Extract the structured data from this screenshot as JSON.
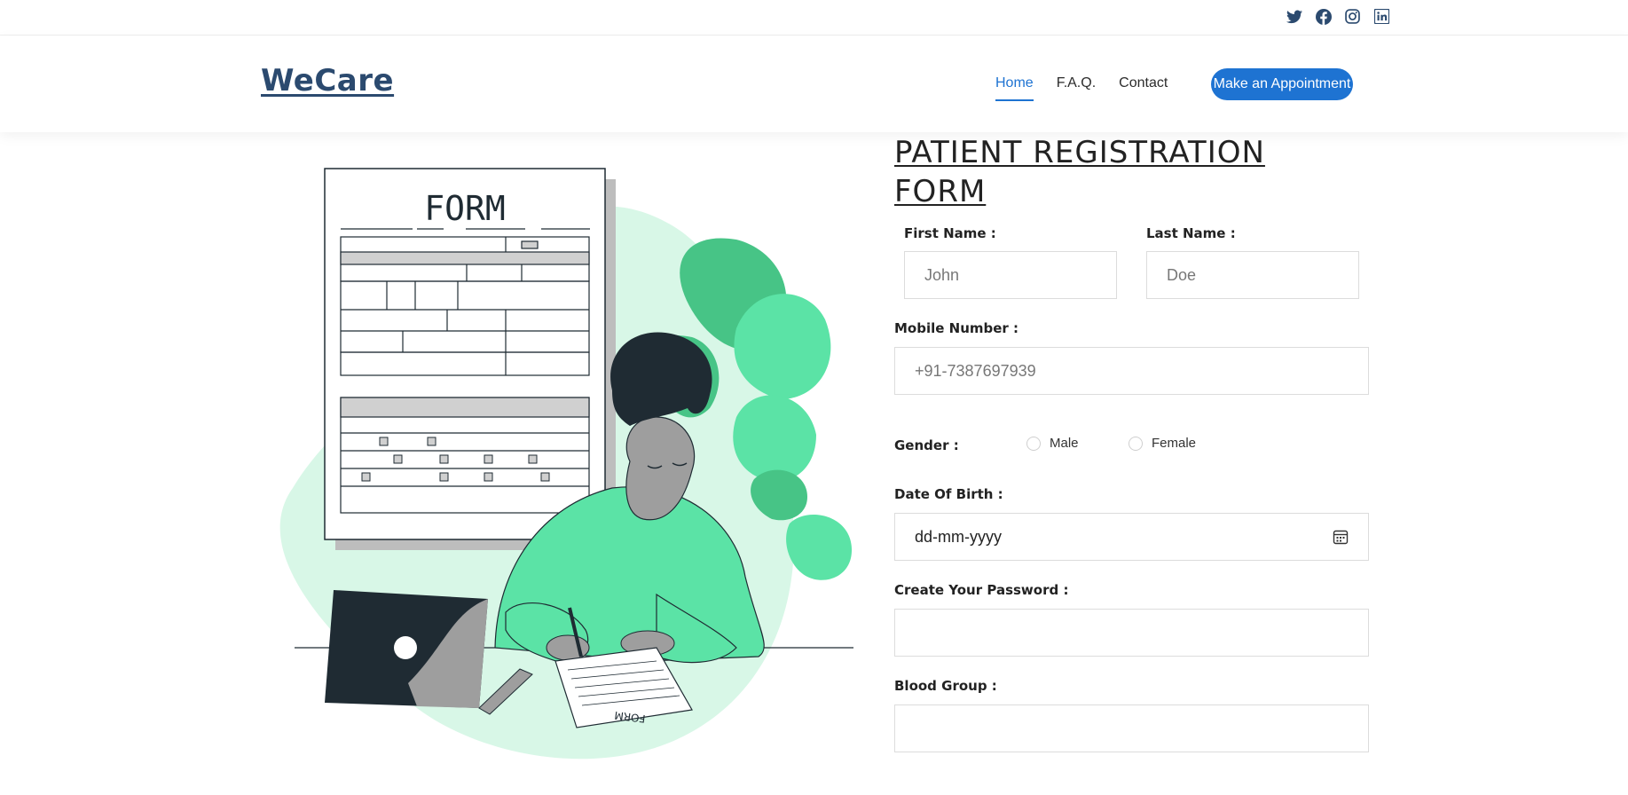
{
  "social": [
    "twitter-icon",
    "facebook-icon",
    "instagram-icon",
    "linkedin-icon"
  ],
  "header": {
    "logo": "WeCare",
    "nav": [
      {
        "label": "Home",
        "active": true
      },
      {
        "label": "F.A.Q.",
        "active": false
      },
      {
        "label": "Contact",
        "active": false
      }
    ],
    "cta": "Make an Appointment"
  },
  "illustration": {
    "form_heading": "FORM",
    "paper_label": "FORM"
  },
  "form": {
    "title": "PATIENT REGISTRATION FORM",
    "first_name": {
      "label": "First Name :",
      "placeholder": "John"
    },
    "last_name": {
      "label": "Last Name :",
      "placeholder": "Doe"
    },
    "mobile": {
      "label": "Mobile Number :",
      "placeholder": "+91-7387697939"
    },
    "gender": {
      "label": "Gender :",
      "options": [
        "Male",
        "Female"
      ]
    },
    "dob": {
      "label": "Date Of Birth :",
      "value": "dd-mm-yyyy",
      "icon": "calendar-icon"
    },
    "password": {
      "label": "Create Your Password :",
      "placeholder": ""
    },
    "blood_group": {
      "label": "Blood Group :",
      "placeholder": ""
    }
  },
  "colors": {
    "accent": "#1e73d2",
    "logo": "#2b4a6f",
    "illus_green": "#5be3a6",
    "illus_blob": "#d8f7e7",
    "illus_dark": "#1f2b33",
    "leaf": "#47c486"
  }
}
